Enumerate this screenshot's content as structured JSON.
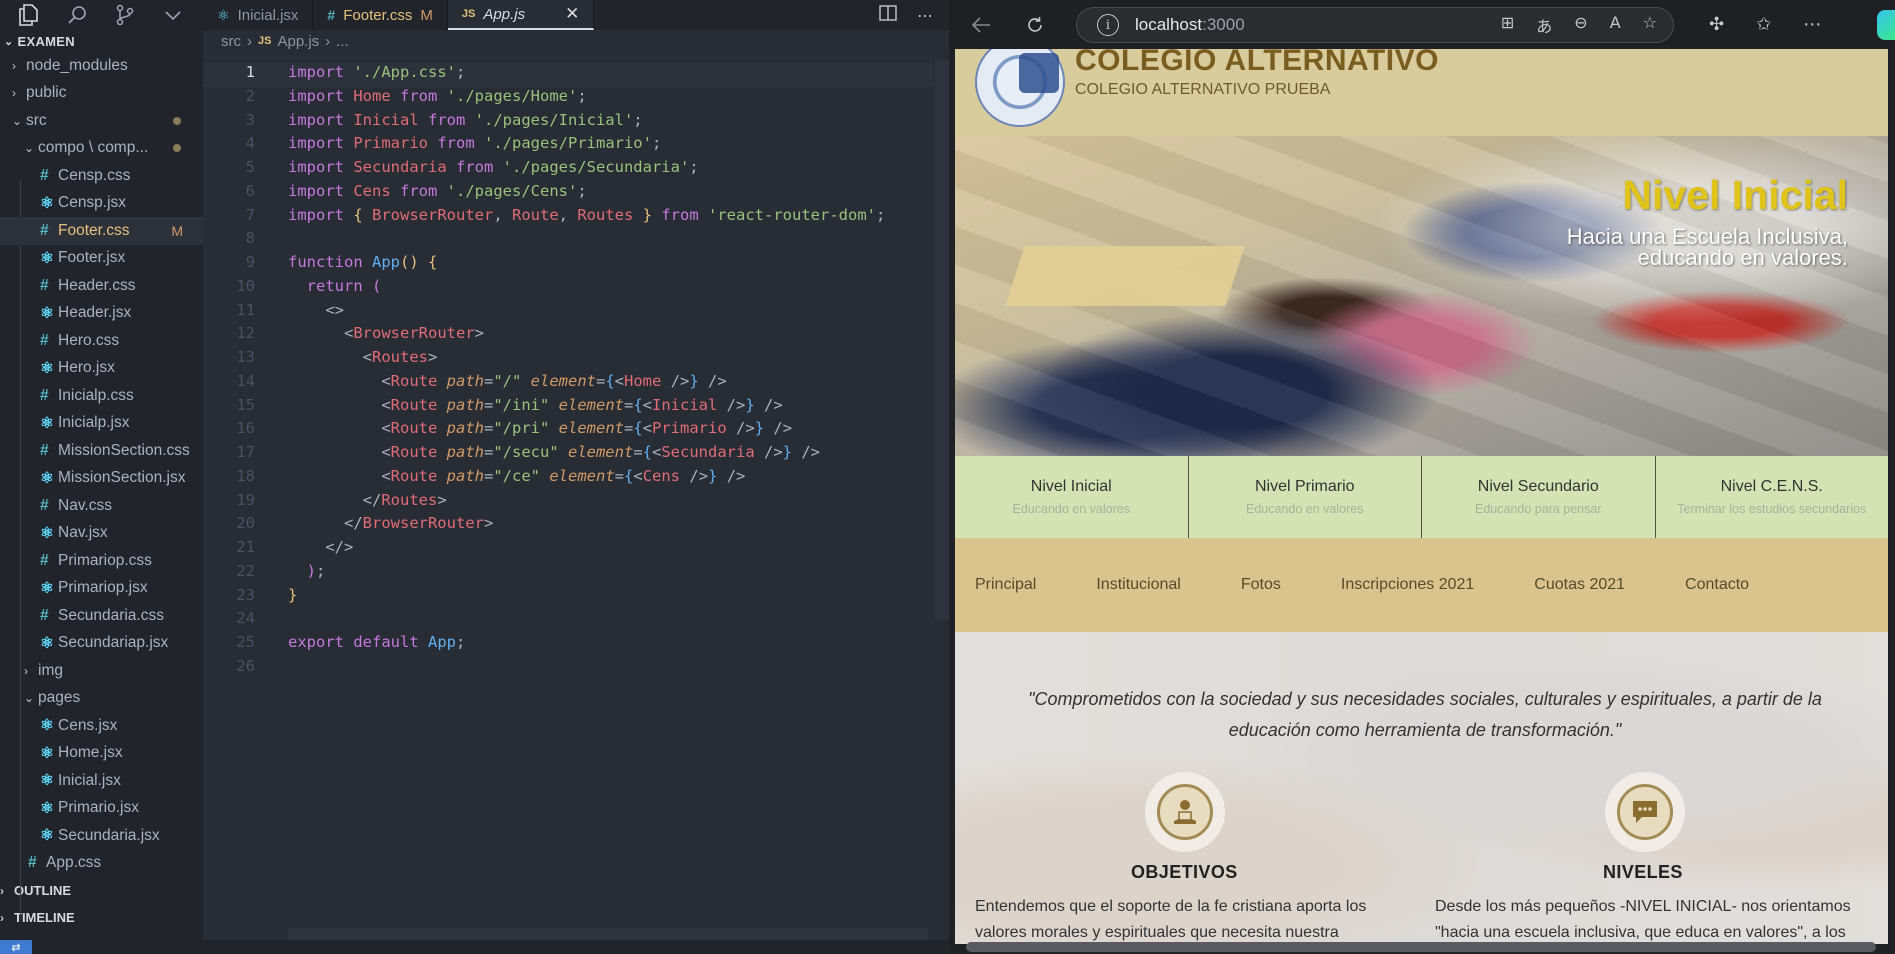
{
  "vscode": {
    "tabs": [
      {
        "icon": "react",
        "label": "Inicial.jsx",
        "modified": ""
      },
      {
        "icon": "#",
        "label": "Footer.css",
        "modified": "M"
      },
      {
        "icon": "JS",
        "label": "App.js",
        "modified": ""
      }
    ],
    "explorer_title": "EXAMEN",
    "tree": [
      {
        "type": "folder",
        "name": "node_modules",
        "depth": 0,
        "open": false
      },
      {
        "type": "folder",
        "name": "public",
        "depth": 0,
        "open": false
      },
      {
        "type": "folder",
        "name": "src",
        "depth": 0,
        "open": true,
        "dot": true
      },
      {
        "type": "folder",
        "name": "compo \\ comp...",
        "depth": 1,
        "open": true,
        "dot": true
      },
      {
        "type": "css",
        "name": "Censp.css",
        "depth": 2
      },
      {
        "type": "jsx",
        "name": "Censp.jsx",
        "depth": 2
      },
      {
        "type": "css",
        "name": "Footer.css",
        "depth": 2,
        "git": "M",
        "selected": true
      },
      {
        "type": "jsx",
        "name": "Footer.jsx",
        "depth": 2
      },
      {
        "type": "css",
        "name": "Header.css",
        "depth": 2
      },
      {
        "type": "jsx",
        "name": "Header.jsx",
        "depth": 2
      },
      {
        "type": "css",
        "name": "Hero.css",
        "depth": 2
      },
      {
        "type": "jsx",
        "name": "Hero.jsx",
        "depth": 2
      },
      {
        "type": "css",
        "name": "Inicialp.css",
        "depth": 2
      },
      {
        "type": "jsx",
        "name": "Inicialp.jsx",
        "depth": 2
      },
      {
        "type": "css",
        "name": "MissionSection.css",
        "depth": 2
      },
      {
        "type": "jsx",
        "name": "MissionSection.jsx",
        "depth": 2
      },
      {
        "type": "css",
        "name": "Nav.css",
        "depth": 2
      },
      {
        "type": "jsx",
        "name": "Nav.jsx",
        "depth": 2
      },
      {
        "type": "css",
        "name": "Primariop.css",
        "depth": 2
      },
      {
        "type": "jsx",
        "name": "Primariop.jsx",
        "depth": 2
      },
      {
        "type": "css",
        "name": "Secundaria.css",
        "depth": 2
      },
      {
        "type": "jsx",
        "name": "Secundariap.jsx",
        "depth": 2
      },
      {
        "type": "folder",
        "name": "img",
        "depth": 1,
        "open": false
      },
      {
        "type": "folder",
        "name": "pages",
        "depth": 1,
        "open": true
      },
      {
        "type": "jsx",
        "name": "Cens.jsx",
        "depth": 2
      },
      {
        "type": "jsx",
        "name": "Home.jsx",
        "depth": 2
      },
      {
        "type": "jsx",
        "name": "Inicial.jsx",
        "depth": 2
      },
      {
        "type": "jsx",
        "name": "Primario.jsx",
        "depth": 2
      },
      {
        "type": "jsx",
        "name": "Secundaria.jsx",
        "depth": 2
      },
      {
        "type": "css",
        "name": "App.css",
        "depth": 1
      }
    ],
    "outline_label": "OUTLINE",
    "timeline_label": "TIMELINE",
    "breadcrumb": [
      "src",
      "App.js",
      "..."
    ],
    "current_line": 1,
    "code_lines": [
      [
        [
          "kw",
          "import "
        ],
        [
          "str",
          "'./App.css'"
        ],
        [
          "pl",
          ";"
        ]
      ],
      [
        [
          "kw",
          "import "
        ],
        [
          "id",
          "Home "
        ],
        [
          "kw",
          "from "
        ],
        [
          "str",
          "'./pages/Home'"
        ],
        [
          "pl",
          ";"
        ]
      ],
      [
        [
          "kw",
          "import "
        ],
        [
          "id",
          "Inicial "
        ],
        [
          "kw",
          "from "
        ],
        [
          "str",
          "'./pages/Inicial'"
        ],
        [
          "pl",
          ";"
        ]
      ],
      [
        [
          "kw",
          "import "
        ],
        [
          "id",
          "Primario "
        ],
        [
          "kw",
          "from "
        ],
        [
          "str",
          "'./pages/Primario'"
        ],
        [
          "pl",
          ";"
        ]
      ],
      [
        [
          "kw",
          "import "
        ],
        [
          "id",
          "Secundaria "
        ],
        [
          "kw",
          "from "
        ],
        [
          "str",
          "'./pages/Secundaria'"
        ],
        [
          "pl",
          ";"
        ]
      ],
      [
        [
          "kw",
          "import "
        ],
        [
          "id",
          "Cens "
        ],
        [
          "kw",
          "from "
        ],
        [
          "str",
          "'./pages/Cens'"
        ],
        [
          "pl",
          ";"
        ]
      ],
      [
        [
          "kw",
          "import "
        ],
        [
          "br1",
          "{ "
        ],
        [
          "id",
          "BrowserRouter"
        ],
        [
          "pl",
          ", "
        ],
        [
          "id",
          "Route"
        ],
        [
          "pl",
          ", "
        ],
        [
          "id",
          "Routes "
        ],
        [
          "br1",
          "} "
        ],
        [
          "kw",
          "from "
        ],
        [
          "str",
          "'react-router-dom'"
        ],
        [
          "pl",
          ";"
        ]
      ],
      [],
      [
        [
          "kw",
          "function "
        ],
        [
          "fn",
          "App"
        ],
        [
          "br1",
          "() {"
        ]
      ],
      [
        [
          "pl",
          "  "
        ],
        [
          "kw",
          "return "
        ],
        [
          "br2",
          "("
        ]
      ],
      [
        [
          "pl",
          "    "
        ],
        [
          "pl",
          "<>"
        ]
      ],
      [
        [
          "pl",
          "      <"
        ],
        [
          "tag",
          "BrowserRouter"
        ],
        [
          "pl",
          ">"
        ]
      ],
      [
        [
          "pl",
          "        <"
        ],
        [
          "tag",
          "Routes"
        ],
        [
          "pl",
          ">"
        ]
      ],
      [
        [
          "pl",
          "          <"
        ],
        [
          "tag",
          "Route "
        ],
        [
          "attr",
          "path"
        ],
        [
          "pl",
          "="
        ],
        [
          "str",
          "\"/\" "
        ],
        [
          "attr",
          "element"
        ],
        [
          "pl",
          "="
        ],
        [
          "br3",
          "{"
        ],
        [
          "pl",
          "<"
        ],
        [
          "tag",
          "Home "
        ],
        [
          "pl",
          "/>"
        ],
        [
          "br3",
          "}"
        ],
        [
          "pl",
          " />"
        ]
      ],
      [
        [
          "pl",
          "          <"
        ],
        [
          "tag",
          "Route "
        ],
        [
          "attr",
          "path"
        ],
        [
          "pl",
          "="
        ],
        [
          "str",
          "\"/ini\" "
        ],
        [
          "attr",
          "element"
        ],
        [
          "pl",
          "="
        ],
        [
          "br3",
          "{"
        ],
        [
          "pl",
          "<"
        ],
        [
          "tag",
          "Inicial "
        ],
        [
          "pl",
          "/>"
        ],
        [
          "br3",
          "}"
        ],
        [
          "pl",
          " />"
        ]
      ],
      [
        [
          "pl",
          "          <"
        ],
        [
          "tag",
          "Route "
        ],
        [
          "attr",
          "path"
        ],
        [
          "pl",
          "="
        ],
        [
          "str",
          "\"/pri\" "
        ],
        [
          "attr",
          "element"
        ],
        [
          "pl",
          "="
        ],
        [
          "br3",
          "{"
        ],
        [
          "pl",
          "<"
        ],
        [
          "tag",
          "Primario "
        ],
        [
          "pl",
          "/>"
        ],
        [
          "br3",
          "}"
        ],
        [
          "pl",
          " />"
        ]
      ],
      [
        [
          "pl",
          "          <"
        ],
        [
          "tag",
          "Route "
        ],
        [
          "attr",
          "path"
        ],
        [
          "pl",
          "="
        ],
        [
          "str",
          "\"/secu\" "
        ],
        [
          "attr",
          "element"
        ],
        [
          "pl",
          "="
        ],
        [
          "br3",
          "{"
        ],
        [
          "pl",
          "<"
        ],
        [
          "tag",
          "Secundaria "
        ],
        [
          "pl",
          "/>"
        ],
        [
          "br3",
          "}"
        ],
        [
          "pl",
          " />"
        ]
      ],
      [
        [
          "pl",
          "          <"
        ],
        [
          "tag",
          "Route "
        ],
        [
          "attr",
          "path"
        ],
        [
          "pl",
          "="
        ],
        [
          "str",
          "\"/ce\" "
        ],
        [
          "attr",
          "element"
        ],
        [
          "pl",
          "="
        ],
        [
          "br3",
          "{"
        ],
        [
          "pl",
          "<"
        ],
        [
          "tag",
          "Cens "
        ],
        [
          "pl",
          "/>"
        ],
        [
          "br3",
          "}"
        ],
        [
          "pl",
          " />"
        ]
      ],
      [
        [
          "pl",
          "        </"
        ],
        [
          "tag",
          "Routes"
        ],
        [
          "pl",
          ">"
        ]
      ],
      [
        [
          "pl",
          "      </"
        ],
        [
          "tag",
          "BrowserRouter"
        ],
        [
          "pl",
          ">"
        ]
      ],
      [
        [
          "pl",
          "    </>"
        ]
      ],
      [
        [
          "pl",
          "  "
        ],
        [
          "br2",
          ")"
        ],
        [
          "pl",
          ";"
        ]
      ],
      [
        [
          "br1",
          "}"
        ]
      ],
      [],
      [
        [
          "kw",
          "export "
        ],
        [
          "kw",
          "default "
        ],
        [
          "fn",
          "App"
        ],
        [
          "pl",
          ";"
        ]
      ],
      []
    ]
  },
  "browser": {
    "url_host": "localhost",
    "url_port": ":3000",
    "site": {
      "title": "COLEGIO ALTERNATIVO",
      "subtitle": "COLEGIO ALTERNATIVO PRUEBA",
      "hero_title": "Nivel Inicial",
      "hero_sub_line1": "Hacia una Escuela Inclusiva,",
      "hero_sub_line2": "educando en valores.",
      "levels": [
        {
          "name": "Nivel Inicial",
          "desc": "Educando en valores"
        },
        {
          "name": "Nivel Primario",
          "desc": "Educando en valores"
        },
        {
          "name": "Nivel Secundario",
          "desc": "Educando para pensar"
        },
        {
          "name": "Nivel C.E.N.S.",
          "desc": "Terminar los estudios secundarios"
        }
      ],
      "nav": [
        "Principal",
        "Institucional",
        "Fotos",
        "Inscripciones 2021",
        "Cuotas 2021",
        "Contacto"
      ],
      "quote": "\"Comprometidos con la sociedad y sus necesidades sociales, culturales y espirituales, a partir de la educación como herramienta de transformación.\"",
      "features": [
        {
          "title": "OBJETIVOS",
          "text": "Entendemos que el soporte de la fe cristiana aporta los valores morales y espirituales que necesita nuestra"
        },
        {
          "title": "NIVELES",
          "text": "Desde los más pequeños -NIVEL INICIAL- nos orientamos \"hacia una escuela inclusiva, que educa en valores\", a los"
        }
      ]
    }
  }
}
